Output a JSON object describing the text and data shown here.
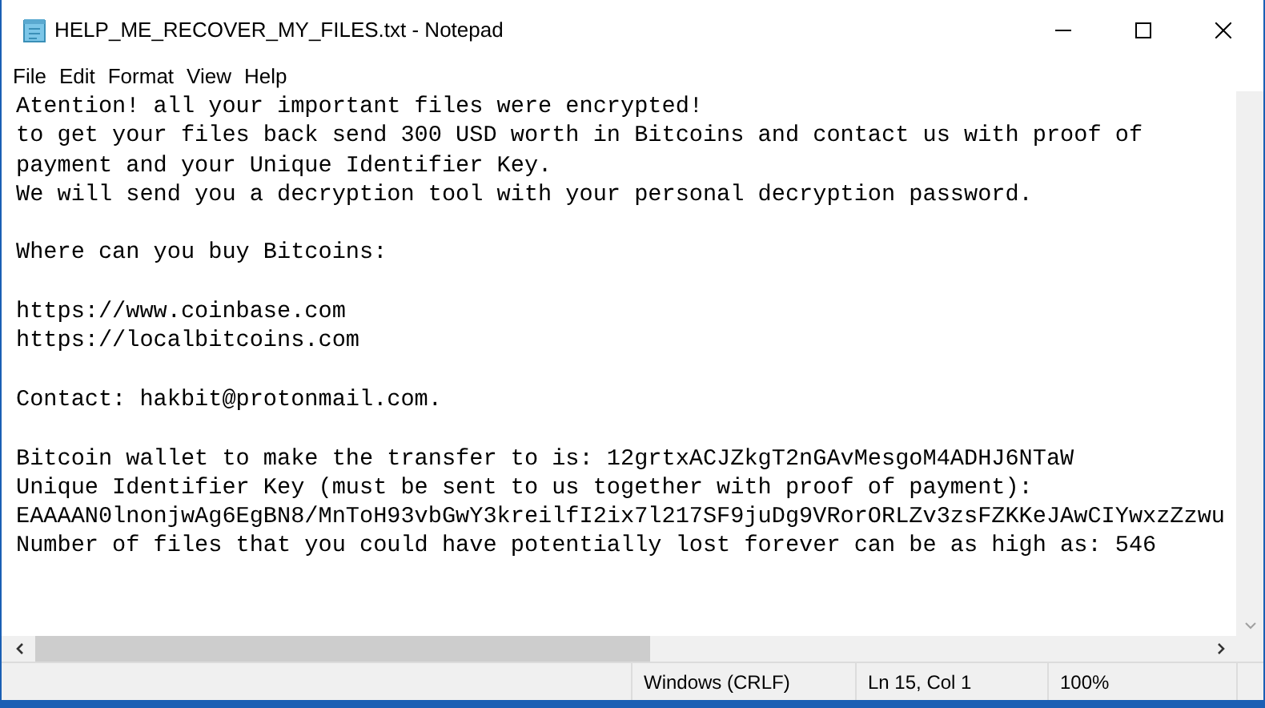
{
  "window": {
    "title": "HELP_ME_RECOVER_MY_FILES.txt - Notepad"
  },
  "menu": [
    "File",
    "Edit",
    "Format",
    "View",
    "Help"
  ],
  "text_blocks": [
    [
      "Atention! all your important files were encrypted!",
      "to get your files back send 300 USD worth in Bitcoins and contact us with proof of",
      "payment and your Unique Identifier Key.",
      "We will send you a decryption tool with your personal decryption password."
    ],
    [
      "Where can you buy Bitcoins:"
    ],
    [
      "https://www.coinbase.com",
      "https://localbitcoins.com"
    ],
    [
      "Contact: hakbit@protonmail.com."
    ],
    [
      "Bitcoin wallet to make the transfer to is: 12grtxACJZkgT2nGAvMesgoM4ADHJ6NTaW",
      "Unique Identifier Key (must be sent to us together with proof of payment):",
      "EAAAAN0lnonjwAg6EgBN8/MnToH93vbGwY3kreilfI2ix7l217SF9juDg9VRorORLZv3zsFZKKeJAwCIYwxzZzwu",
      "Number of files that you could have potentially lost forever can be as high as: 546"
    ]
  ],
  "status_bar": [
    "Windows (CRLF)",
    "Ln 15, Col 1",
    "100%"
  ]
}
